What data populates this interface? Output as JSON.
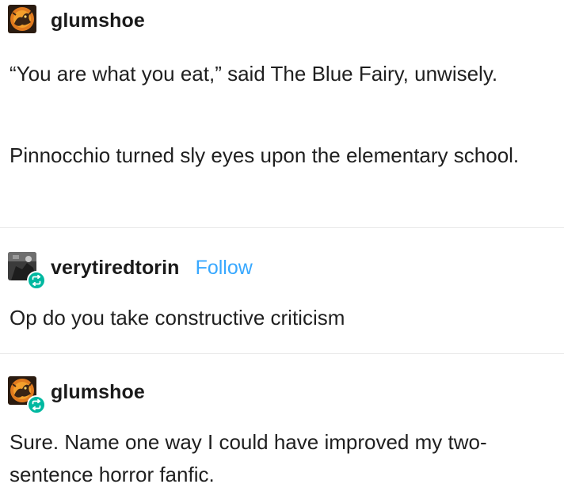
{
  "posts": [
    {
      "username": "glumshoe",
      "avatar_icon": "fire-creature-avatar-icon",
      "paragraphs": [
        "“You are what you eat,” said The Blue Fairy, unwisely.",
        "Pinnocchio turned sly eyes upon the elementary school."
      ]
    },
    {
      "username": "verytiredtorin",
      "follow_label": "Follow",
      "avatar_icon": "dark-photo-avatar-icon",
      "badge_icon": "reblog-icon",
      "paragraphs": [
        "Op do you take constructive criticism"
      ]
    },
    {
      "username": "glumshoe",
      "avatar_icon": "fire-creature-avatar-icon",
      "badge_icon": "reblog-icon",
      "paragraphs": [
        "Sure. Name one way I could have improved my two-sentence horror fanfic."
      ]
    }
  ],
  "colors": {
    "follow": "#38a8ff",
    "reblog_badge": "#00b8a0",
    "divider": "#e8e8e8",
    "text": "#1f1f1f"
  }
}
